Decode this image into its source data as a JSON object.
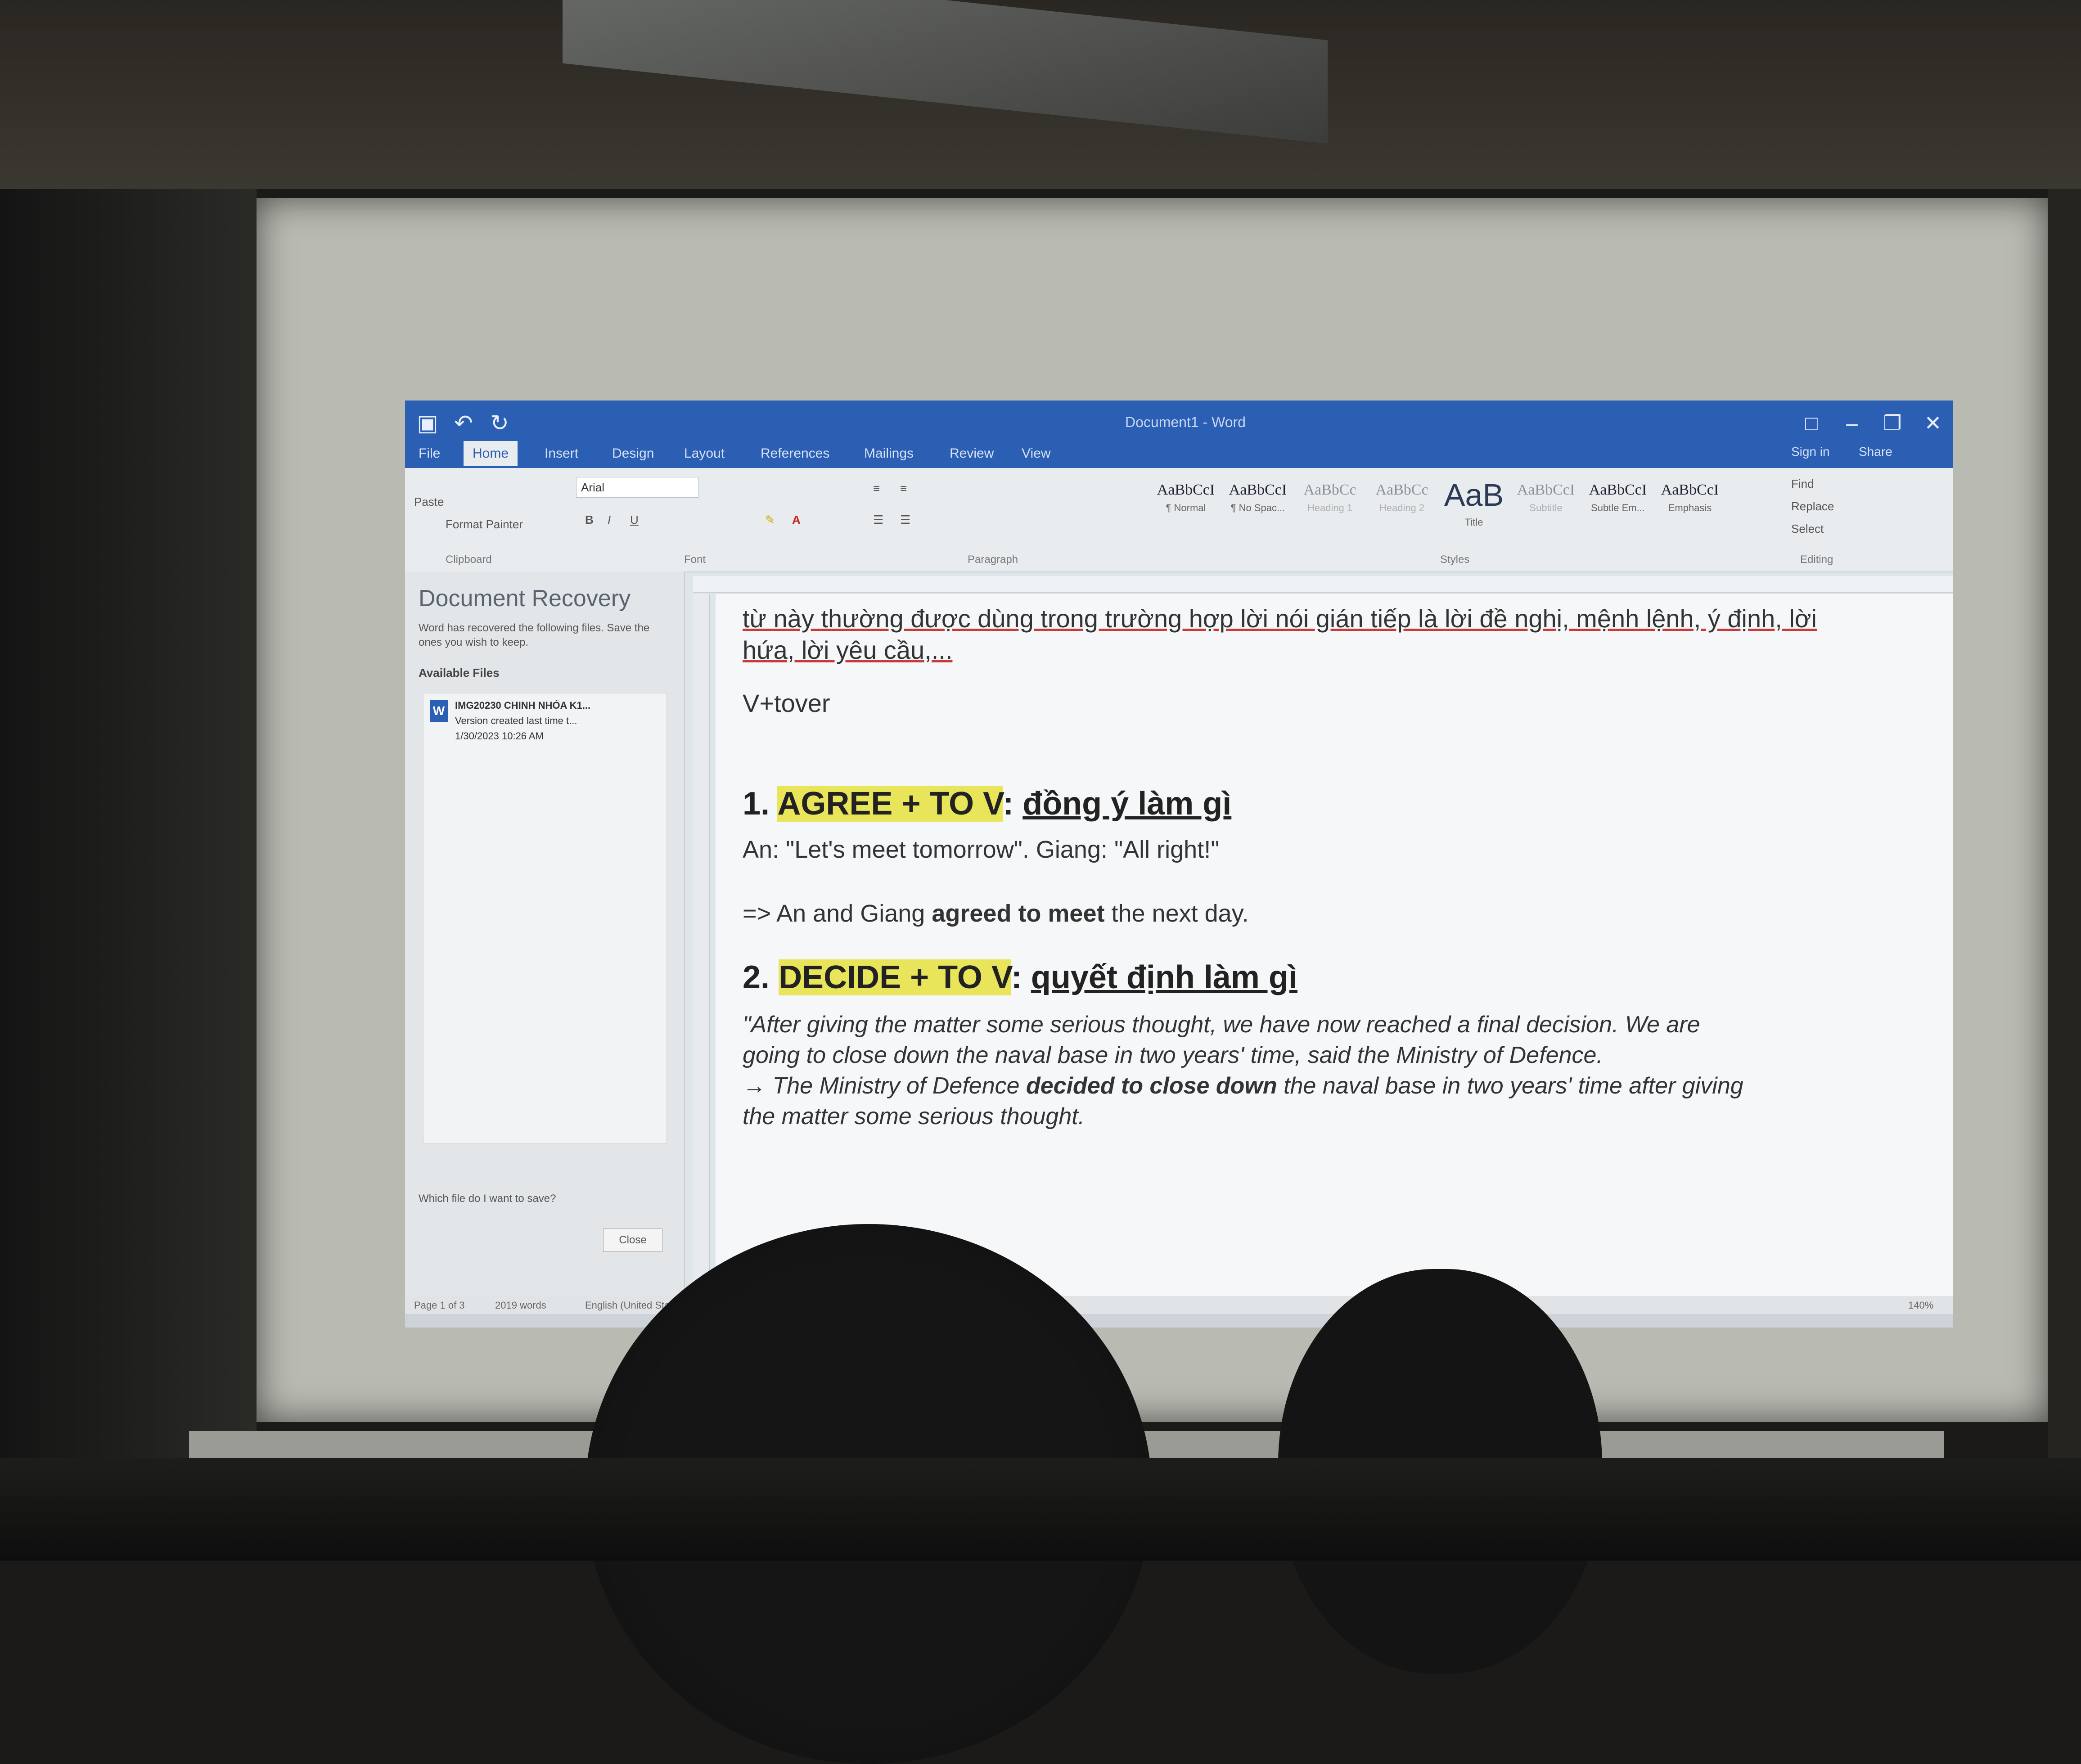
{
  "window": {
    "title": "Document1 - Word"
  },
  "quick_access": {
    "save_icon": "save-icon",
    "undo_icon": "undo-icon",
    "redo_icon": "redo-icon"
  },
  "ribbon_tabs": [
    {
      "label": "File"
    },
    {
      "label": "Home"
    },
    {
      "label": "Insert"
    },
    {
      "label": "Design"
    },
    {
      "label": "Layout"
    },
    {
      "label": "References"
    },
    {
      "label": "Mailings"
    },
    {
      "label": "Review"
    },
    {
      "label": "View"
    }
  ],
  "ribbon_right": {
    "signin": "Sign in",
    "share": "Share"
  },
  "ribbon": {
    "format_painter": "Format Painter",
    "paste": "Paste",
    "font_name": "Arial",
    "group_clipboard": "Clipboard",
    "group_font": "Font",
    "group_paragraph": "Paragraph",
    "group_styles": "Styles",
    "styles": [
      {
        "sample": "AaBbCcI",
        "label": "¶ Normal"
      },
      {
        "sample": "AaBbCcI",
        "label": "¶ No Spac..."
      },
      {
        "sample": "AaBbCc",
        "label": "Heading 1"
      },
      {
        "sample": "AaBbCc",
        "label": "Heading 2"
      },
      {
        "sample": "AaB",
        "label": "Title"
      },
      {
        "sample": "AaBbCcI",
        "label": "Subtitle"
      },
      {
        "sample": "AaBbCcI",
        "label": "Subtle Em..."
      },
      {
        "sample": "AaBbCcI",
        "label": "Emphasis"
      }
    ],
    "find": "Find",
    "replace": "Replace",
    "select": "Select",
    "group_editing": "Editing"
  },
  "recovery": {
    "title": "Document Recovery",
    "subtitle": "Word has recovered the following files. Save the ones you wish to keep.",
    "available": "Available Files",
    "file_name": "IMG20230 CHINH NHÓA K1...",
    "file_version": "Version created last time t...",
    "file_date": "1/30/2023 10:26 AM",
    "question": "Which file do I want to save?",
    "close": "Close"
  },
  "document": {
    "line1": "từ này thường được dùng trong trường hợp lời nói gián tiếp là lời đề nghị, mệnh lệnh, ý định, lời",
    "line2": "hứa, lời yêu cầu,...",
    "vtover": "V+tover",
    "h1_num": "1.",
    "h1_hl": "AGREE + TO V",
    "h1_vi": "đồng ý làm gì",
    "ex1": "An: \"Let's meet tomorrow\". Giang: \"All right!\"",
    "ex1_result_a": "=> An and Giang ",
    "ex1_result_b": "agreed to meet",
    "ex1_result_c": " the next day.",
    "h2_num": "2.",
    "h2_hl": "DECIDE + TO V",
    "h2_vi": "quyết định làm gì",
    "quote1": "\"After giving the matter some serious thought, we have now reached a final decision. We are",
    "quote2": "going to close down the naval base in two years' time, said the Ministry of Defence.",
    "arrow_a": "→ The Ministry of Defence ",
    "arrow_b": "decided to close down",
    "arrow_c": " the naval base in two years' time after giving",
    "arrow2": "the matter some serious thought."
  },
  "status": {
    "page": "Page 1 of 3",
    "words": "2019 words",
    "lang": "English (United States)",
    "zoom": "140%"
  }
}
